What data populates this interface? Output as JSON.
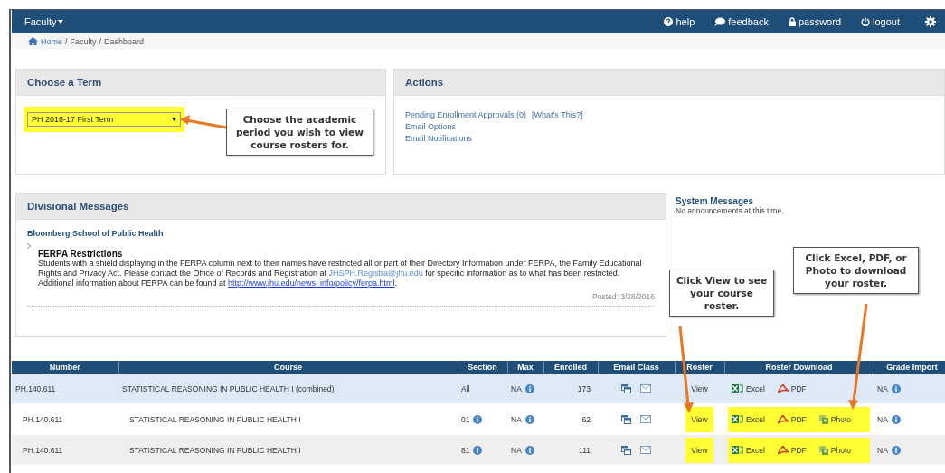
{
  "navbar": {
    "menu": "Faculty",
    "links": [
      {
        "kind": "help",
        "label": "help"
      },
      {
        "kind": "feedback",
        "label": "feedback"
      },
      {
        "kind": "password",
        "label": "password"
      },
      {
        "kind": "logout",
        "label": "logout"
      }
    ],
    "settings": true
  },
  "breadcrumb": {
    "items": [
      "Home",
      "Faculty",
      "Dashboard"
    ],
    "separator": "/"
  },
  "term_panel": {
    "title": "Choose a Term",
    "select": {
      "value": "PH 2016-17 First Term",
      "highlighted": true
    }
  },
  "actions_panel": {
    "title": "Actions",
    "links": [
      "Pending Enrollment Approvals (0)",
      "Email Options",
      "Email Notifications"
    ],
    "help_link": "[What's This?]"
  },
  "divisional_messages": {
    "title": "Divisional Messages",
    "school": "Bloomberg School of Public Health",
    "message": {
      "title": "FERPA Restrictions",
      "text_1": "Students with a shield displaying in the FERPA column next to their names have restricted all or part of their Directory Information under FERPA, the Family Educational Rights and Privacy Act. Please contact the Office of Records and Registration at",
      "email": "JHSPH.Registra@jhu.edu",
      "text_2": "for specific information as to what has been restricted. Additional information about FERPA can be found at",
      "url": "http://www.jhu.edu/news_info/policy/ferpa.html",
      "text_3": "."
    },
    "posted": "Posted: 3/28/2016"
  },
  "system_messages": {
    "title": "System Messages",
    "text": "No announcements at this time."
  },
  "table": {
    "columns": [
      "Number",
      "Course",
      "Section",
      "Max",
      "Enrolled",
      "Email Class",
      "Roster",
      "Roster Download",
      "Grade Import"
    ],
    "rows": [
      {
        "kind": "combined",
        "number": "PH.140.611",
        "course": "STATISTICAL REASONING IN PUBLIC HEALTH I (combined)",
        "section": "All",
        "section_info": false,
        "max": "NA",
        "enrolled": "173",
        "roster": "View",
        "roster_highlighted": false,
        "downloads": [
          {
            "kind": "excel",
            "label": "Excel"
          },
          {
            "kind": "pdf",
            "label": "PDF"
          }
        ],
        "downloads_highlighted": false,
        "grade_import": "NA"
      },
      {
        "kind": "section",
        "number": "PH.140.611",
        "course": "STATISTICAL REASONING IN PUBLIC HEALTH I",
        "section": "01",
        "section_info": true,
        "max": "NA",
        "enrolled": "62",
        "roster": "View",
        "roster_highlighted": true,
        "downloads": [
          {
            "kind": "excel",
            "label": "Excel"
          },
          {
            "kind": "pdf",
            "label": "PDF"
          },
          {
            "kind": "photo",
            "label": "Photo"
          }
        ],
        "downloads_highlighted": true,
        "grade_import": "NA"
      },
      {
        "kind": "section",
        "number": "PH.140.611",
        "course": "STATISTICAL REASONING IN PUBLIC HEALTH I",
        "section": "81",
        "section_info": true,
        "max": "NA",
        "enrolled": "111",
        "roster": "View",
        "roster_highlighted": true,
        "downloads": [
          {
            "kind": "excel",
            "label": "Excel"
          },
          {
            "kind": "pdf",
            "label": "PDF"
          },
          {
            "kind": "photo",
            "label": "Photo"
          }
        ],
        "downloads_highlighted": true,
        "grade_import": "NA"
      }
    ]
  },
  "callouts": [
    {
      "kind": "term",
      "text": "Choose the academic period you wish to view course rosters for."
    },
    {
      "kind": "view",
      "text": "Click View to see your course roster."
    },
    {
      "kind": "download",
      "text": "Click Excel, PDF, or Photo to download your roster."
    }
  ]
}
